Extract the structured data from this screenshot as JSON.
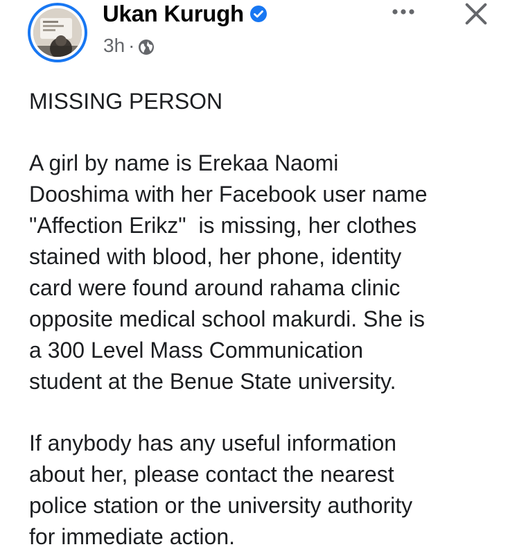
{
  "post": {
    "author": {
      "name": "Ukan Kurugh",
      "verified": true,
      "avatar_icon": "profile-photo"
    },
    "meta": {
      "time": "3h",
      "separator": "·",
      "audience_icon": "globe-icon"
    },
    "header_actions": {
      "more_icon": "more-options-icon",
      "close_icon": "close-icon"
    },
    "body": {
      "heading": "MISSING PERSON",
      "paragraph_1_lines": [
        "A girl by name is Erekaa Naomi",
        "Dooshima with her Facebook user name",
        "\"Affection Erikz\"  is missing, her clothes",
        "stained with blood, her phone, identity",
        "card were found around rahama clinic",
        "opposite medical school makurdi. She is",
        "a 300 Level Mass Communication",
        "student at the Benue State university."
      ],
      "paragraph_2_lines": [
        "If anybody has any useful information",
        "about her, please contact the nearest",
        "police station or the university authority",
        "for immediate action."
      ]
    }
  },
  "colors": {
    "accent_blue": "#1877f2",
    "secondary_text": "#65676b",
    "primary_text": "#1c1e21"
  }
}
